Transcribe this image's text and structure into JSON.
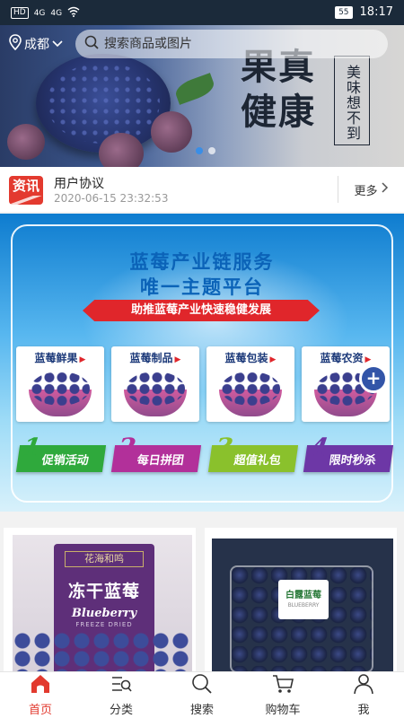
{
  "status_bar": {
    "network_tag": "HD",
    "signal1": "4G",
    "signal2": "4G",
    "battery": "55",
    "time": "18:17"
  },
  "header": {
    "location": "成都",
    "search_placeholder": "搜索商品或图片"
  },
  "banner": {
    "main_slogan": "果真健康",
    "sub_slogan": "美味想不到",
    "slide_count": 2,
    "active_slide": 1
  },
  "news": {
    "badge": "资讯",
    "title": "用户协议",
    "time": "2020-06-15 23:32:53",
    "more_label": "更多"
  },
  "promo": {
    "title_line1": "蓝莓产业链服务",
    "title_line2": "唯一主题平台",
    "ribbon": "助推蓝莓产业快速稳健发展",
    "categories": [
      {
        "label": "蓝莓鲜果"
      },
      {
        "label": "蓝莓制品"
      },
      {
        "label": "蓝莓包装"
      },
      {
        "label": "蓝莓农资"
      }
    ],
    "activities": [
      {
        "num": "1",
        "label": "促销活动"
      },
      {
        "num": "2",
        "label": "每日拼团"
      },
      {
        "num": "3",
        "label": "超值礼包"
      },
      {
        "num": "4",
        "label": "限时秒杀"
      }
    ]
  },
  "products": [
    {
      "brand": "花海和鸣",
      "name": "冻干蓝莓",
      "en_name": "Blueberry",
      "en_sub": "FREEZE DRIED"
    },
    {
      "label": "白露蓝莓",
      "label_sub": "BLUEBERRY"
    }
  ],
  "tabbar": {
    "items": [
      {
        "label": "首页",
        "icon": "home-icon",
        "active": true
      },
      {
        "label": "分类",
        "icon": "category-icon",
        "active": false
      },
      {
        "label": "搜索",
        "icon": "search-icon",
        "active": false
      },
      {
        "label": "购物车",
        "icon": "cart-icon",
        "active": false
      },
      {
        "label": "我",
        "icon": "user-icon",
        "active": false
      }
    ]
  },
  "colors": {
    "accent": "#e23a2f",
    "status_bar": "#1b2a3a"
  }
}
